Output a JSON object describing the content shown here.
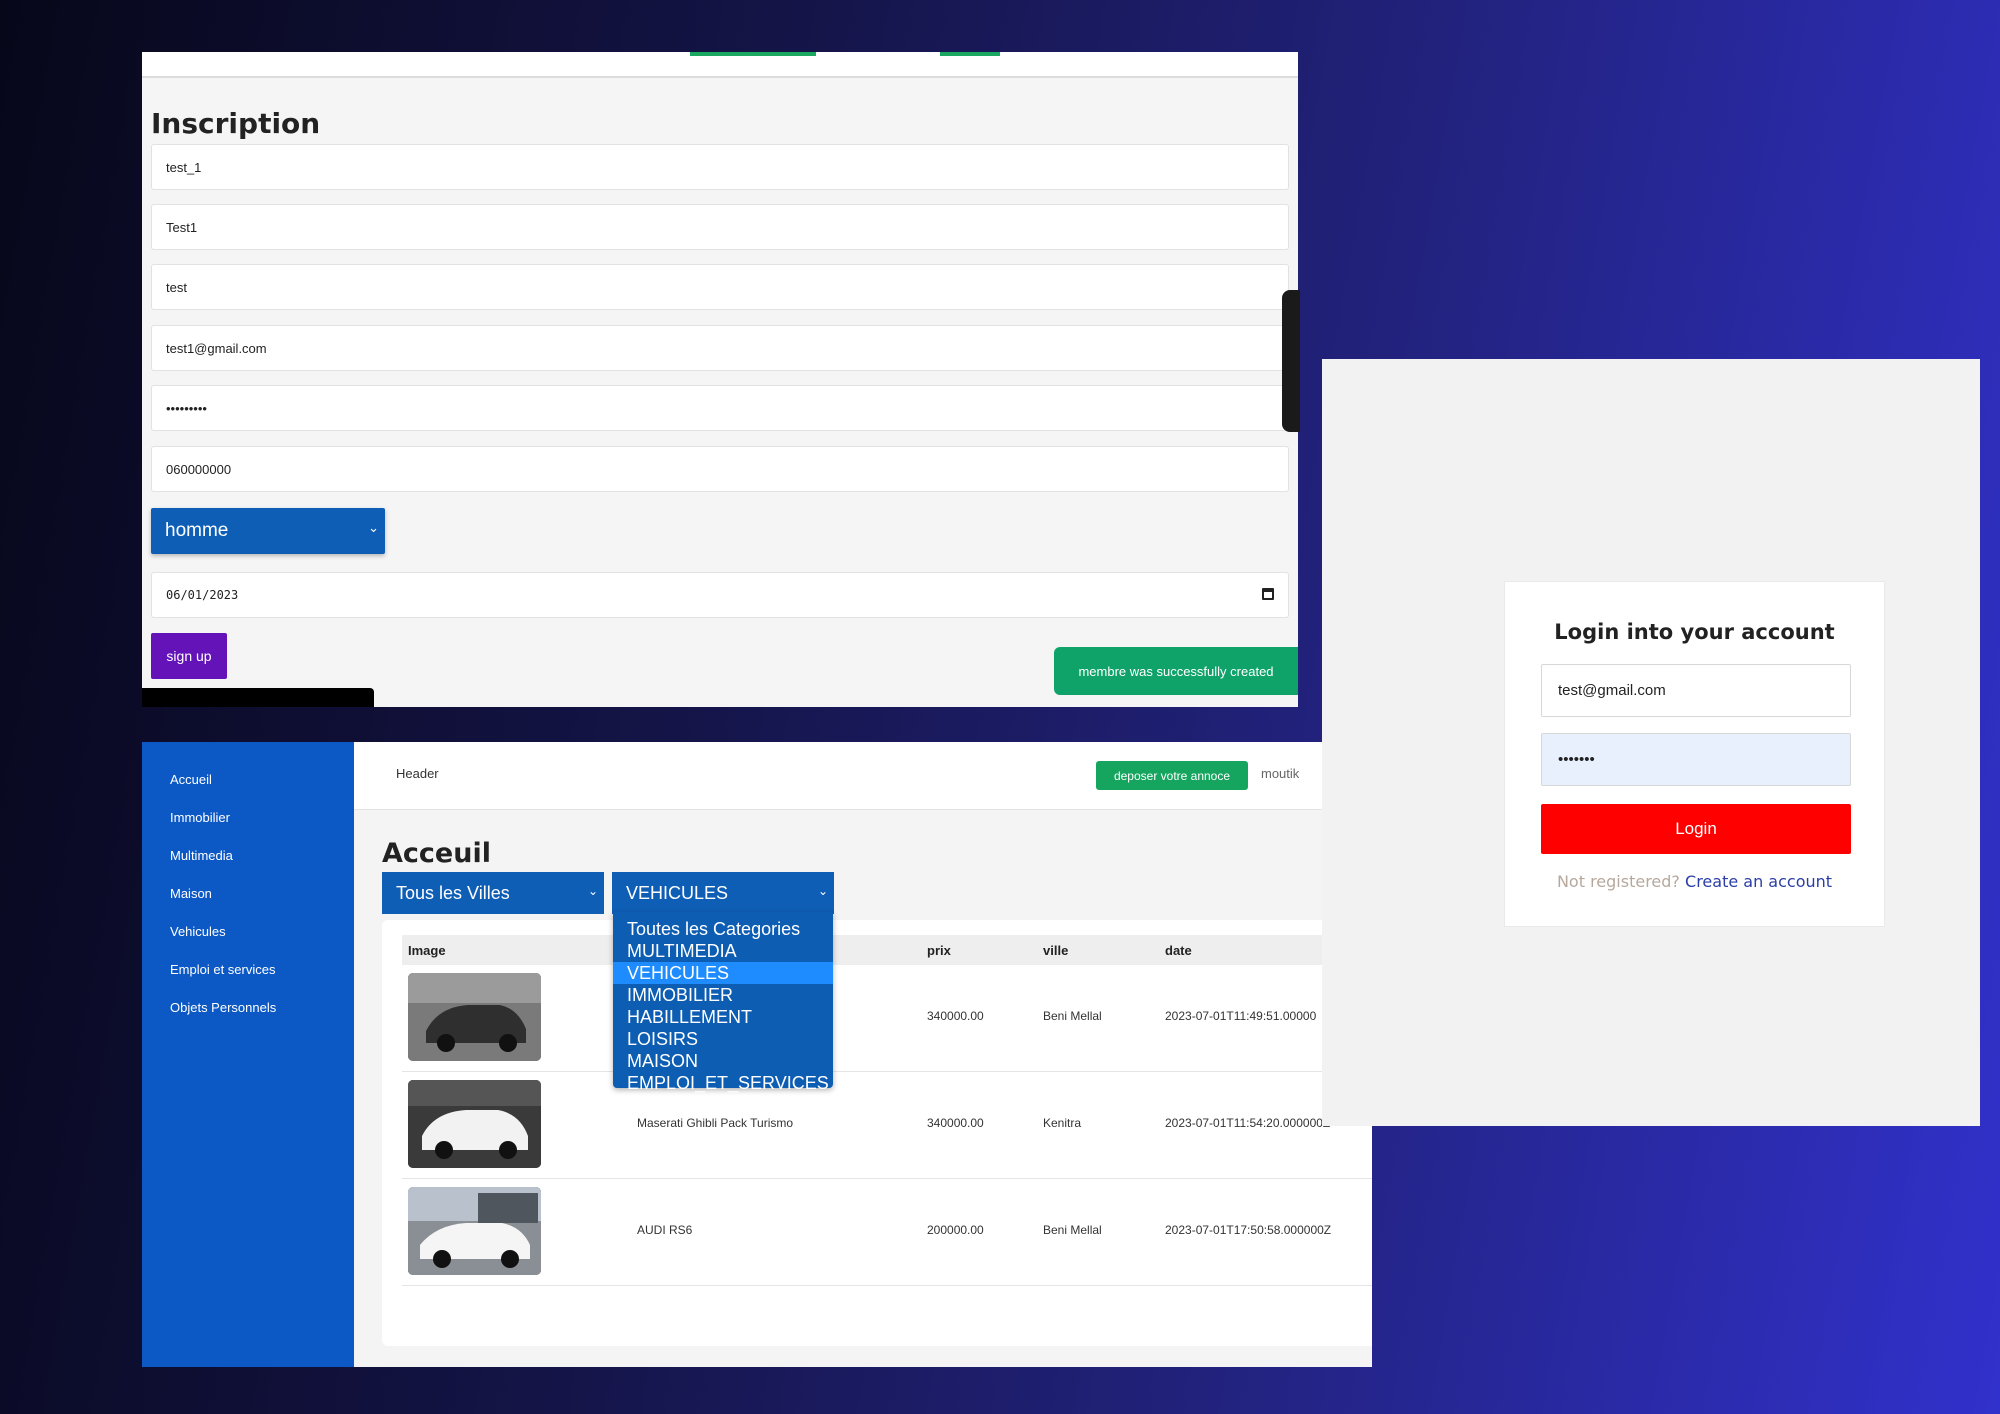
{
  "signup": {
    "title": "Inscription",
    "fields": [
      "test_1",
      "Test1",
      "test",
      "test1@gmail.com",
      "•••••••••",
      "060000000"
    ],
    "gender_selected": "homme",
    "date": "06/01/2023",
    "submit_label": "sign up",
    "toast": "membre was successfully created"
  },
  "home": {
    "sidebar": [
      "Accueil",
      "Immobilier",
      "Multimedia",
      "Maison",
      "Vehicules",
      "Emploi et services",
      "Objets Personnels"
    ],
    "header_label": "Header",
    "post_button": "deposer votre annoce",
    "username": "moutik",
    "title": "Acceuil",
    "city_filter": "Tous les Villes",
    "category_filter": "VEHICULES",
    "category_options": [
      "Toutes les Categories",
      "MULTIMEDIA",
      "VEHICULES",
      "IMMOBILIER",
      "HABILLEMENT",
      "LOISIRS",
      "MAISON",
      "EMPLOI_ET_SERVICES"
    ],
    "columns": [
      "Image",
      "prix",
      "ville",
      "date"
    ],
    "rows": [
      {
        "title": "",
        "prix": "340000.00",
        "ville": "Beni Mellal",
        "date": "2023-07-01T11:49:51.00000"
      },
      {
        "title": "Maserati Ghibli Pack Turismo",
        "prix": "340000.00",
        "ville": "Kenitra",
        "date": "2023-07-01T11:54:20.000000Z"
      },
      {
        "title": "AUDI RS6",
        "prix": "200000.00",
        "ville": "Beni Mellal",
        "date": "2023-07-01T17:50:58.000000Z"
      }
    ]
  },
  "login": {
    "title": "Login into your account",
    "email": "test@gmail.com",
    "password": "•••••••",
    "button": "Login",
    "footer_muted": "Not registered?",
    "footer_link": "Create an account"
  },
  "colors": {
    "primary_blue": "#0c59c6",
    "green": "#16a55f",
    "purple_button": "#6313b8",
    "login_red": "#ff0000"
  }
}
